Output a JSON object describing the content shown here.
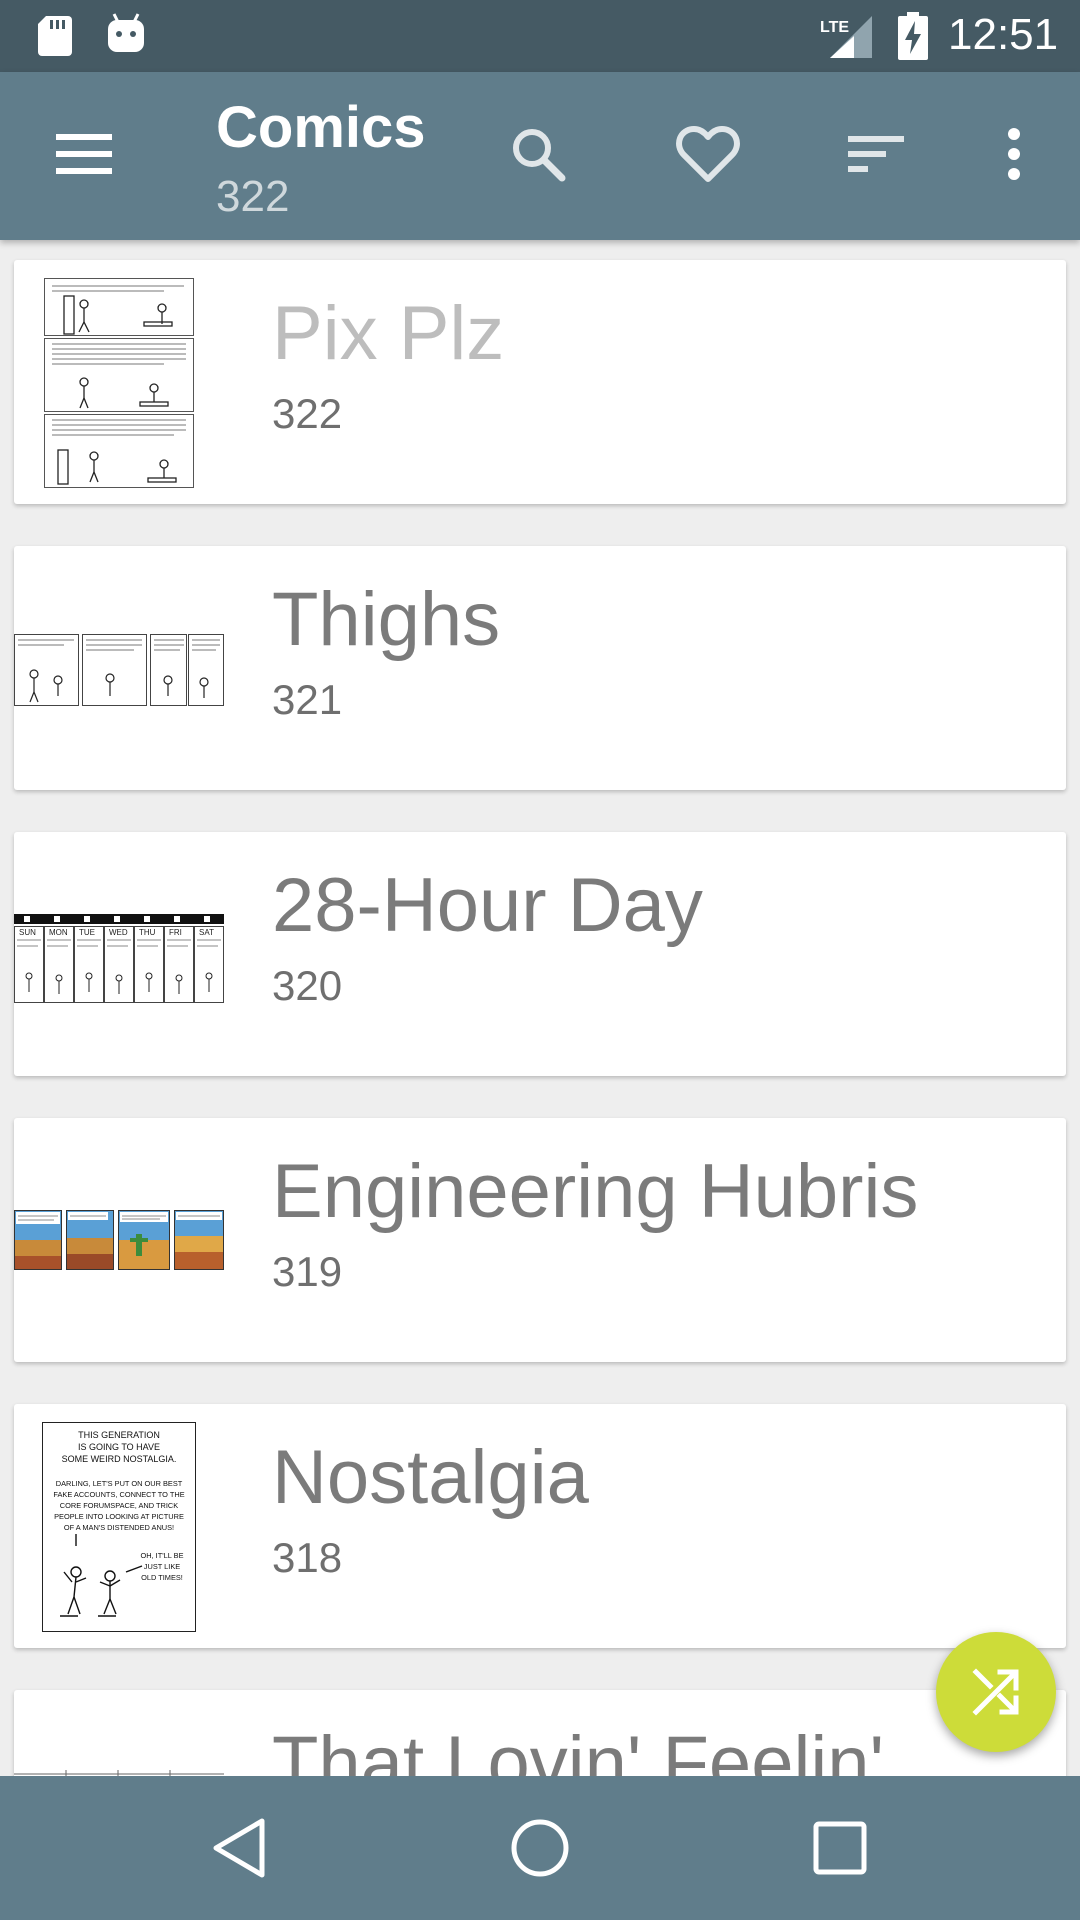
{
  "status_bar": {
    "time": "12:51",
    "network": "LTE",
    "icons": [
      "sd-card-icon",
      "android-icon",
      "lte-signal-icon",
      "battery-charging-icon"
    ]
  },
  "app_bar": {
    "title": "Comics",
    "subtitle": "322",
    "icons": [
      "menu-icon",
      "search-icon",
      "heart-icon",
      "sort-icon",
      "more-vert-icon"
    ]
  },
  "comics": [
    {
      "title": "Pix Plz",
      "number": "322"
    },
    {
      "title": "Thighs",
      "number": "321"
    },
    {
      "title": "28-Hour Day",
      "number": "320"
    },
    {
      "title": "Engineering Hubris",
      "number": "319"
    },
    {
      "title": "Nostalgia",
      "number": "318"
    },
    {
      "title": "That Lovin' Feelin'",
      "number": ""
    }
  ],
  "thumbnail_text": {
    "nostalgia_lines": [
      "THIS GENERATION",
      "IS GOING TO HAVE",
      "SOME WEIRD NOSTALGIA.",
      "DARLING, LET'S PUT ON OUR BEST",
      "FAKE ACCOUNTS, CONNECT TO THE",
      "CORE FORUMSPACE, AND TRICK",
      "PEOPLE INTO LOOKING AT PICTURE",
      "OF A MAN'S DISTENDED ANUS!",
      "OH, IT'LL BE",
      "JUST LIKE",
      "OLD TIMES!"
    ],
    "day_labels": [
      "SUN",
      "MON",
      "TUE",
      "WED",
      "THU",
      "FRI",
      "SAT"
    ]
  },
  "fab": {
    "icon": "shuffle-icon"
  },
  "nav_bar": {
    "icons": [
      "back-icon",
      "home-icon",
      "recents-icon"
    ]
  },
  "colors": {
    "status_bar": "#455a64",
    "app_bar": "#607d8b",
    "fab": "#cddc39",
    "background": "#eeeeee"
  }
}
